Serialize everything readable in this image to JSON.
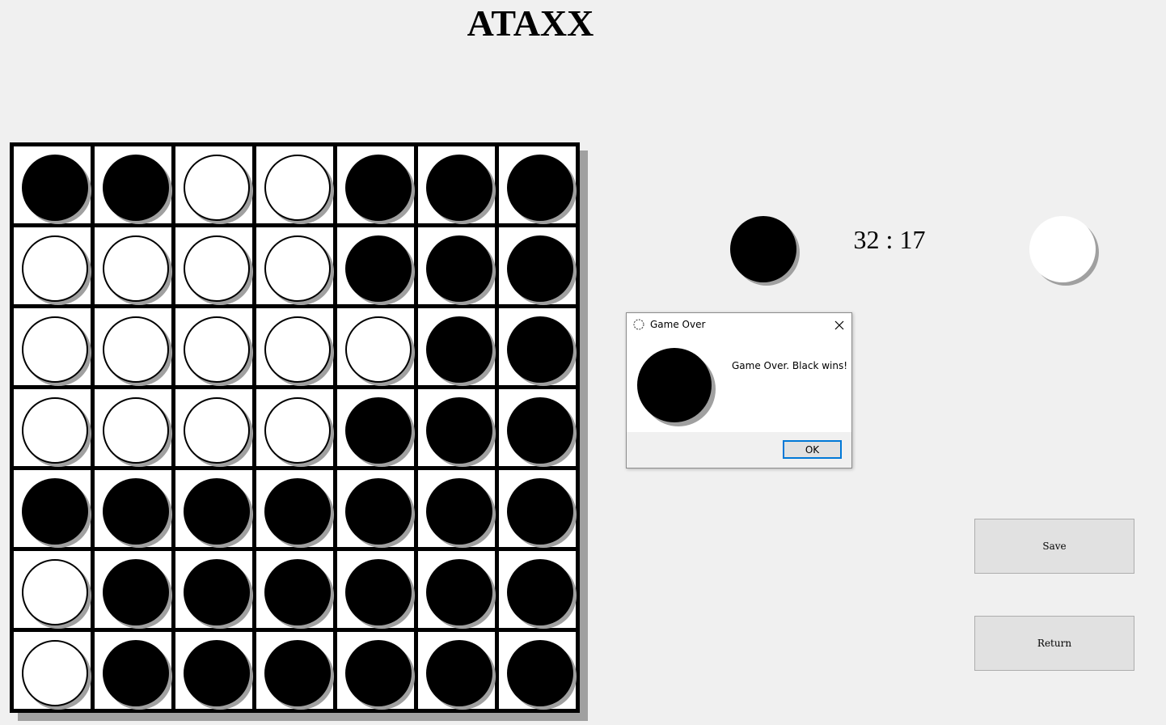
{
  "title": "ATAXX",
  "board": {
    "rows": 7,
    "cols": 7,
    "cells": [
      [
        "black",
        "black",
        "white",
        "white",
        "black",
        "black",
        "black"
      ],
      [
        "white",
        "white",
        "white",
        "white",
        "black",
        "black",
        "black"
      ],
      [
        "white",
        "white",
        "white",
        "white",
        "white",
        "black",
        "black"
      ],
      [
        "white",
        "white",
        "white",
        "white",
        "black",
        "black",
        "black"
      ],
      [
        "black",
        "black",
        "black",
        "black",
        "black",
        "black",
        "black"
      ],
      [
        "white",
        "black",
        "black",
        "black",
        "black",
        "black",
        "black"
      ],
      [
        "white",
        "black",
        "black",
        "black",
        "black",
        "black",
        "black"
      ]
    ]
  },
  "score": {
    "text": "32 : 17",
    "black": 32,
    "white": 17,
    "left_player_color": "black",
    "right_player_color": "white"
  },
  "buttons": {
    "save_label": "Save",
    "return_label": "Return"
  },
  "dialog": {
    "title": "Game Over",
    "message": "Game Over. Black wins!",
    "ok_label": "OK",
    "winner_color": "black",
    "icon": "loading-circle-icon",
    "close_icon": "close-icon"
  },
  "colors": {
    "background": "#f0f0f0",
    "board_grid": "#000000",
    "cell": "#ffffff",
    "shadow": "#a0a0a0",
    "black_piece": "#000000",
    "white_piece": "#ffffff",
    "button": "#e1e1e1",
    "focus_border": "#0078d7"
  }
}
